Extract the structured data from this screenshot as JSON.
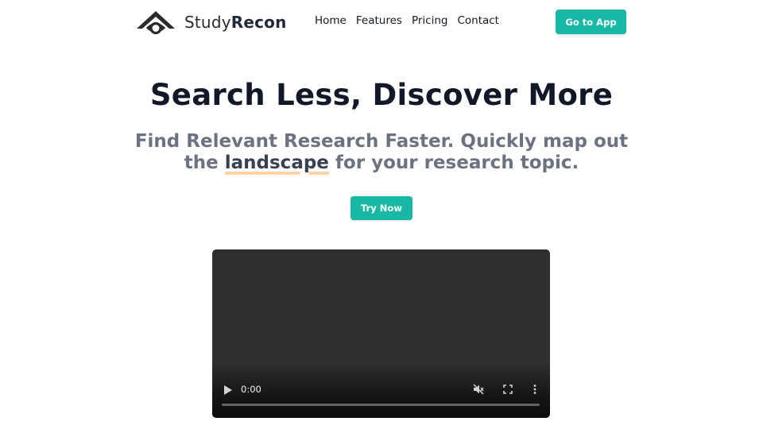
{
  "brand": {
    "name_light": "Study",
    "name_bold": "Recon",
    "logo_icon": "house-eye-logo"
  },
  "nav": {
    "links": [
      "Home",
      "Features",
      "Pricing",
      "Contact"
    ],
    "cta_label": "Go to App"
  },
  "hero": {
    "title": "Search Less, Discover More",
    "subtitle_part1": "Find Relevant Research Faster. Quickly map out the ",
    "subtitle_highlight": "landscape",
    "subtitle_part2": " for your research topic.",
    "cta_label": "Try Now"
  },
  "video": {
    "current_time": "0:00",
    "progress_fraction": 0,
    "muted": true,
    "icons": [
      "play-icon",
      "mute-icon",
      "fullscreen-icon",
      "more-options-icon"
    ]
  },
  "colors": {
    "accent": "#19b8a5",
    "title": "#111827",
    "subtitle": "#6b7280",
    "highlight_underline": "#fcd4a6",
    "video_bg": "#2f2f2f"
  }
}
